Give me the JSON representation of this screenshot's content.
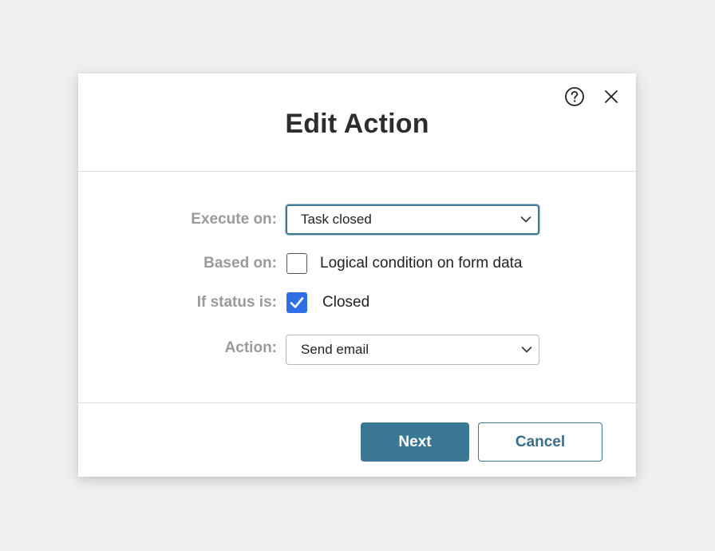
{
  "dialog": {
    "title": "Edit Action",
    "help_icon": "help-circle-icon",
    "close_icon": "close-icon"
  },
  "form": {
    "execute_on": {
      "label": "Execute on:",
      "value": "Task closed"
    },
    "based_on": {
      "label": "Based on:",
      "option_label": "Logical condition on form data",
      "checked": false
    },
    "if_status": {
      "label": "If status is:",
      "option_label": "Closed",
      "checked": true
    },
    "action": {
      "label": "Action:",
      "value": "Send email"
    }
  },
  "footer": {
    "next_label": "Next",
    "cancel_label": "Cancel"
  },
  "colors": {
    "primary": "#3a7896",
    "checkbox_checked": "#2f6fe4",
    "label_gray": "#9a9a9a",
    "title": "#2b2d30"
  }
}
